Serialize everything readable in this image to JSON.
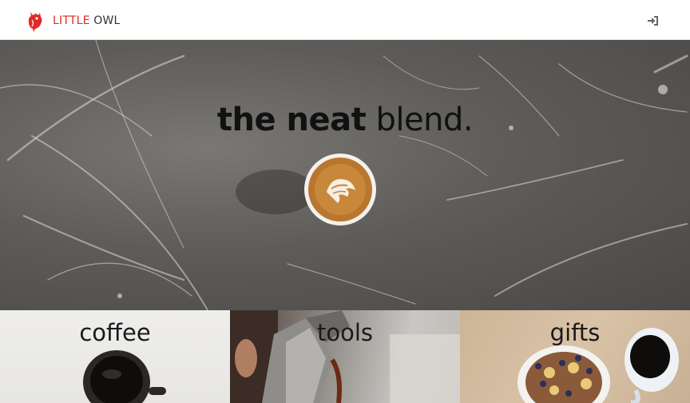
{
  "header": {
    "brand_part1": "LITTLE",
    "brand_part2": "OWL",
    "logo_icon": "owl-logo-icon",
    "login_icon": "sign-in-icon"
  },
  "hero": {
    "tagline_bold": "the neat",
    "tagline_light": "blend."
  },
  "categories": [
    {
      "label": "coffee"
    },
    {
      "label": "tools"
    },
    {
      "label": "gifts"
    }
  ],
  "colors": {
    "brand_red": "#e02a26",
    "text_dark": "#333333"
  }
}
